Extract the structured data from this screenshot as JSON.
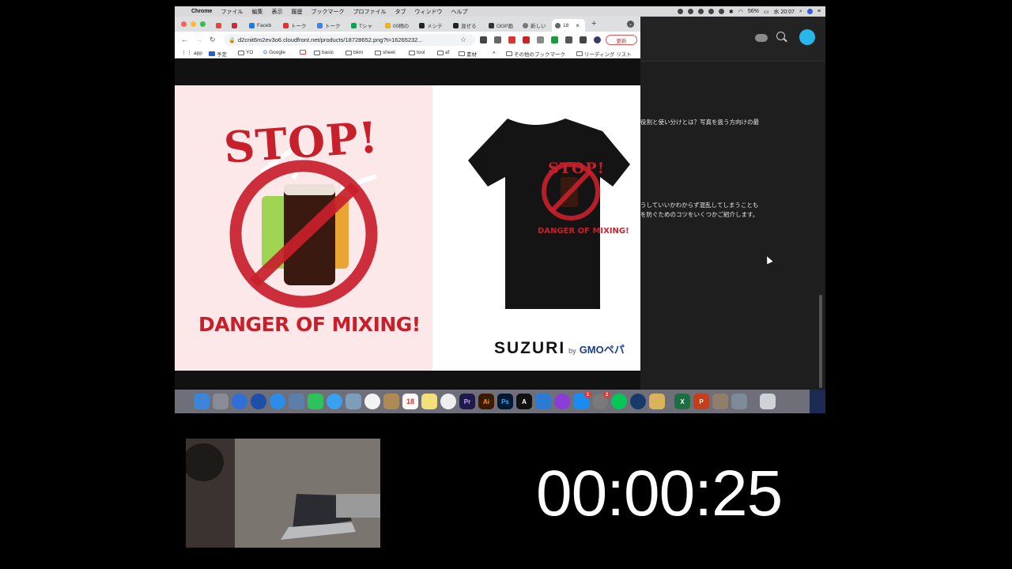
{
  "menubar": {
    "app": "Chrome",
    "items": [
      "ファイル",
      "編集",
      "表示",
      "履歴",
      "ブックマーク",
      "プロファイル",
      "タブ",
      "ウィンドウ",
      "ヘルプ"
    ],
    "battery": "56%",
    "clock": "水 20:07"
  },
  "tabs": [
    {
      "label": "Faceb",
      "color": "#1877f2"
    },
    {
      "label": "トーク",
      "color": "#06c755"
    },
    {
      "label": "トーク",
      "color": "#06c755"
    },
    {
      "label": "Tシャ",
      "color": "#0f9d58"
    },
    {
      "label": "00柄の",
      "color": "#f4b400"
    },
    {
      "label": "メシテ",
      "color": "#222222"
    },
    {
      "label": "混ぜる",
      "color": "#222222"
    },
    {
      "label": "OGP画",
      "color": "#333333"
    },
    {
      "label": "新しい",
      "color": "#444444"
    },
    {
      "label": "18",
      "color": "#555555"
    }
  ],
  "toolbar": {
    "url": "d2cnit6m2ev3o6.cloudfront.net/products/18728652.png?t=16265232...",
    "update_label": "更新"
  },
  "bookmarks": [
    {
      "label": "app"
    },
    {
      "label": "予定"
    },
    {
      "label": "YO"
    },
    {
      "label": "Google"
    },
    {
      "label": "basic"
    },
    {
      "label": "bkm"
    },
    {
      "label": "sheet"
    },
    {
      "label": "tool"
    },
    {
      "label": "af"
    },
    {
      "label": "素材"
    }
  ],
  "bookmarks_more": "»",
  "bookmarks_other": "その他のブックマーク",
  "bookmarks_reading": "リーディング リスト",
  "design": {
    "stop_text": "STOP!",
    "tagline": "DANGER OF MIXING!",
    "shirt_stop": "STOP!",
    "shirt_tagline": "DANGER OF MIXING!",
    "brand": "SUZURI",
    "brand_by": "by",
    "brand_gmo": "GMOペパ"
  },
  "background_app": {
    "line1": "役割と使い分けとは？写真を扱う方向けの最",
    "line2": "うしていいかわからず混乱してしまうことも",
    "line3": "を防ぐためのコツをいくつかご紹介します。"
  },
  "dock": {
    "calendar_day": "18",
    "badge_appstore": "1",
    "badge_settings": "2"
  },
  "timer": "00:00:25",
  "colors": {
    "stop_red": "#c8202b",
    "pink_bg": "#fce7e9",
    "accent_avatar": "#29b6e8"
  }
}
